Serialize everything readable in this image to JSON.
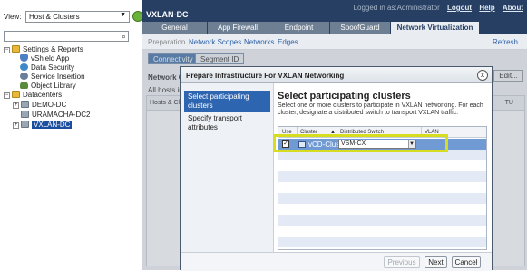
{
  "sidebar": {
    "view_label": "View:",
    "view_value": "Host & Clusters",
    "tree": {
      "settings": "Settings & Reports",
      "vshield": "vShield App",
      "data_security": "Data Security",
      "service_insertion": "Service Insertion",
      "object_library": "Object Library",
      "datacenters": "Datacenters",
      "demo_dc": "DEMO-DC",
      "uramacha": "URAMACHA-DC2",
      "vxlan_dc": "VXLAN-DC"
    }
  },
  "header": {
    "title": "VXLAN-DC",
    "login_text": "Logged in as:Administrator",
    "logout": "Logout",
    "help": "Help",
    "about": "About",
    "tabs": [
      "General",
      "App Firewall",
      "Endpoint",
      "SpoofGuard",
      "Network Virtualization"
    ]
  },
  "subnav": {
    "items": [
      "Preparation",
      "Network Scopes",
      "Networks",
      "Edges"
    ],
    "refresh": "Refresh"
  },
  "content": {
    "connectivity": "Connectivity",
    "segment_id": "Segment ID",
    "network_label": "Network C",
    "all_hosts": "All hosts in",
    "col_hosts": "Hosts & Cl",
    "col_mtu": "TU",
    "edit": "Edit..."
  },
  "dialog": {
    "title": "Prepare Infrastructure For VXLAN Networking",
    "close": "x",
    "steps": [
      "Select participating clusters",
      "Specify transport attributes"
    ],
    "heading": "Select participating clusters",
    "description": "Select one or more clusters to participate in VXLAN networking. For each cluster, designate a distributed switch to transport VXLAN traffic.",
    "columns": [
      "Use",
      "Cluster",
      "Distributed Switch",
      "VLAN"
    ],
    "sort_arrow": "▲",
    "row": {
      "checked": true,
      "cluster": "vCD-Cluster",
      "switch": "VSM-CX",
      "vlan": ""
    },
    "footer": {
      "previous": "Previous",
      "next": "Next",
      "cancel": "Cancel"
    }
  }
}
